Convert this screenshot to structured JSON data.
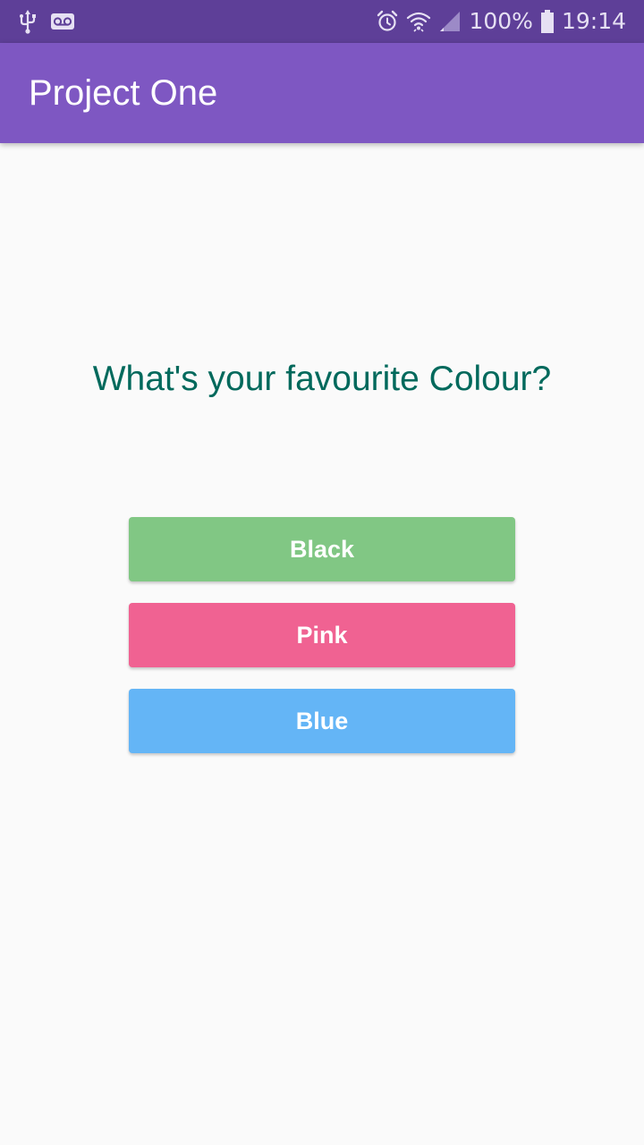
{
  "status_bar": {
    "battery_percent": "100%",
    "time": "19:14",
    "left_icons": [
      "usb-icon",
      "voicemail-icon"
    ],
    "right_icons": [
      "alarm-icon",
      "wifi-icon",
      "signal-icon",
      "battery-icon"
    ],
    "background_color": "#5e3f98"
  },
  "app_bar": {
    "title": "Project One",
    "background_color": "#7e57c2"
  },
  "question": {
    "text": "What's your favourite Colour?",
    "color": "#00695c"
  },
  "answers": [
    {
      "label": "Black",
      "color": "#81c784"
    },
    {
      "label": "Pink",
      "color": "#f06292"
    },
    {
      "label": "Blue",
      "color": "#64b5f6"
    }
  ]
}
